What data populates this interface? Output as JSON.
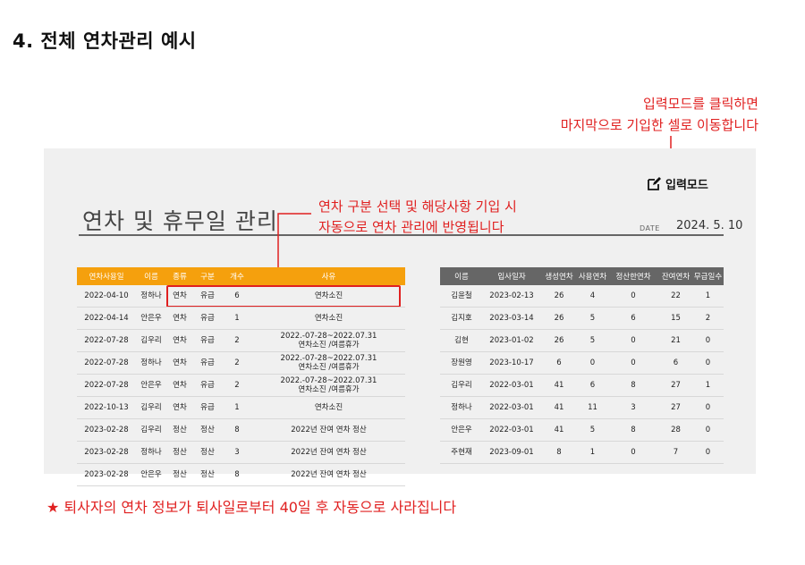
{
  "page": {
    "title": "4. 전체 연차관리 예시"
  },
  "notes": {
    "top_line1": "입력모드를 클릭하면",
    "top_line2": "마지막으로 기입한 셀로 이동합니다",
    "mid_line1": "연차 구분 선택 및 해당사항 기입 시",
    "mid_line2": "자동으로 연차 관리에 반영됩니다",
    "bottom": "★ 퇴사자의 연차 정보가 퇴사일로부터 40일 후 자동으로 사라집니다"
  },
  "sheet": {
    "title": "연차 및 휴무일 관리",
    "input_mode_label": "입력모드",
    "date_label": "DATE",
    "date_value": "2024. 5. 10"
  },
  "left_table": {
    "headers": [
      "연차사용일",
      "이름",
      "종류",
      "구분",
      "개수",
      "사유"
    ],
    "rows": [
      [
        "2022-04-10",
        "정하나",
        "연차",
        "유급",
        "6",
        "연차소진"
      ],
      [
        "2022-04-14",
        "안은우",
        "연차",
        "유급",
        "1",
        "연차소진"
      ],
      [
        "2022-07-28",
        "김우리",
        "연차",
        "유급",
        "2",
        "2022.-07-28~2022.07.31\n연차소진 /여름휴가"
      ],
      [
        "2022-07-28",
        "정하나",
        "연차",
        "유급",
        "2",
        "2022.-07-28~2022.07.31\n연차소진 /여름휴가"
      ],
      [
        "2022-07-28",
        "안은우",
        "연차",
        "유급",
        "2",
        "2022.-07-28~2022.07.31\n연차소진 /여름휴가"
      ],
      [
        "2022-10-13",
        "김우리",
        "연차",
        "유급",
        "1",
        "연차소진"
      ],
      [
        "2023-02-28",
        "김우리",
        "정산",
        "정산",
        "8",
        "2022년 잔여 연차 정산"
      ],
      [
        "2023-02-28",
        "정하나",
        "정산",
        "정산",
        "3",
        "2022년 잔여 연차 정산"
      ],
      [
        "2023-02-28",
        "안은우",
        "정산",
        "정산",
        "8",
        "2022년 잔여 연차 정산"
      ]
    ]
  },
  "right_table": {
    "headers": [
      "이름",
      "입사일자",
      "생성연차",
      "사용연차",
      "정산한연차",
      "잔여연차",
      "무급일수"
    ],
    "rows": [
      [
        "김윤철",
        "2023-02-13",
        "26",
        "4",
        "0",
        "22",
        "1"
      ],
      [
        "김지호",
        "2023-03-14",
        "26",
        "5",
        "6",
        "15",
        "2"
      ],
      [
        "김현",
        "2023-01-02",
        "26",
        "5",
        "0",
        "21",
        "0"
      ],
      [
        "장원영",
        "2023-10-17",
        "6",
        "0",
        "0",
        "6",
        "0"
      ],
      [
        "김우리",
        "2022-03-01",
        "41",
        "6",
        "8",
        "27",
        "1"
      ],
      [
        "정하나",
        "2022-03-01",
        "41",
        "11",
        "3",
        "27",
        "0"
      ],
      [
        "안은우",
        "2022-03-01",
        "41",
        "5",
        "8",
        "28",
        "0"
      ],
      [
        "주현재",
        "2023-09-01",
        "8",
        "1",
        "0",
        "7",
        "0"
      ]
    ]
  },
  "colors": {
    "accent_red": "#e02020",
    "left_header": "#f5a00d",
    "right_header": "#666666",
    "panel_bg": "#f0f0f0"
  },
  "icons": {
    "input_mode": "edit-pencil-icon"
  }
}
